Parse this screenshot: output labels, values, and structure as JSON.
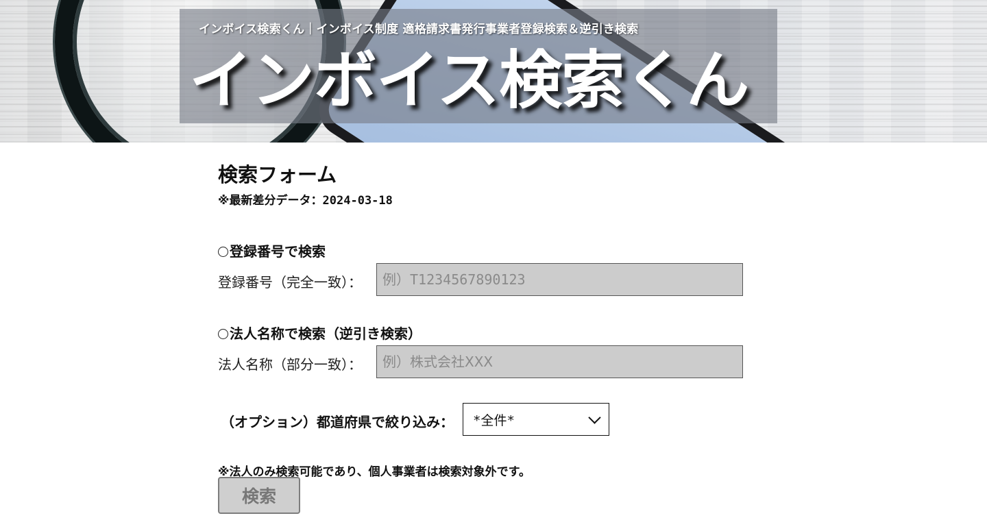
{
  "header": {
    "subtitle": "インボイス検索くん｜インボイス制度 適格請求書発行事業者登録検索＆逆引き検索",
    "title": "インボイス検索くん"
  },
  "form": {
    "title": "検索フォーム",
    "latest_label": "※最新差分データ：",
    "latest_date": "2024-03-18",
    "by_number": {
      "heading": "登録番号で検索",
      "label": "登録番号（完全一致）：",
      "placeholder": "例）T1234567890123",
      "value": ""
    },
    "by_name": {
      "heading": "法人名称で検索（逆引き検索）",
      "label": "法人名称（部分一致）：",
      "placeholder": "例）株式会社XXX",
      "value": ""
    },
    "prefecture": {
      "label": "（オプション）都道府県で絞り込み：",
      "selected": "*全件*"
    },
    "note": "※法人のみ検索可能であり、個人事業者は検索対象外です。",
    "submit_label": "検索"
  },
  "icons": {
    "radio": "radio-circle-icon",
    "dropdown": "chevron-down-icon"
  }
}
